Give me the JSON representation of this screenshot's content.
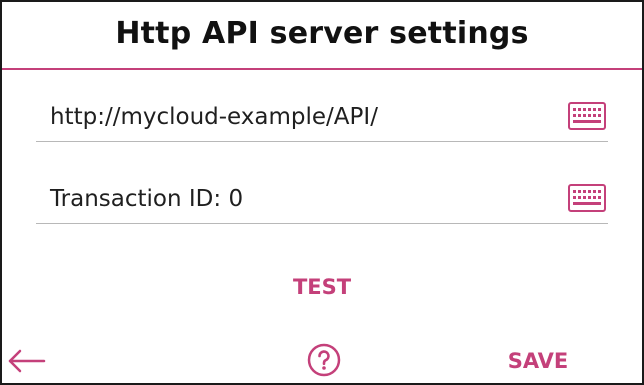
{
  "header": {
    "title": "Http API server settings"
  },
  "fields": [
    {
      "value": "http://mycloud-example/API/",
      "icon": "keyboard-icon"
    },
    {
      "value": "Transaction ID: 0",
      "icon": "keyboard-icon"
    }
  ],
  "actions": {
    "test_label": "TEST",
    "save_label": "SAVE",
    "back_icon": "arrow-left-icon",
    "help_icon": "question-circle-icon"
  },
  "colors": {
    "accent": "#c4407a",
    "text": "#1f1f1f",
    "divider": "#b8b8b8",
    "border": "#1a1a1a"
  }
}
